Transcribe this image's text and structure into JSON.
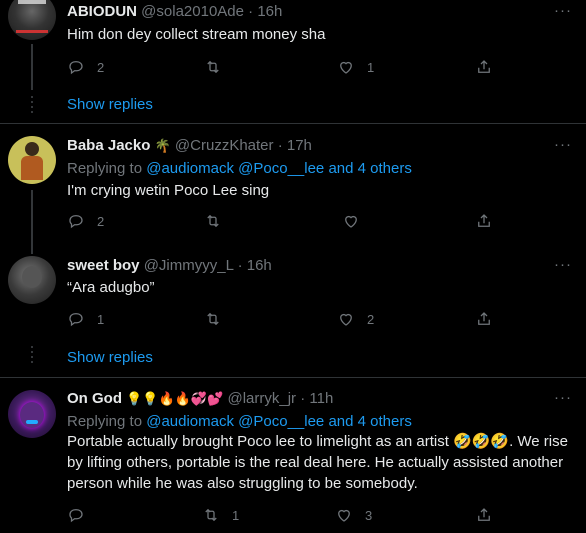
{
  "tweets": [
    {
      "name": "ABIODUN",
      "handle": "@sola2010Ade",
      "time": "16h",
      "text": "Him don dey collect stream money sha",
      "replies": "2",
      "retweets": "",
      "likes": "1",
      "show_replies": "Show replies"
    },
    {
      "name": "Baba Jacko",
      "name_emoji": "🌴",
      "handle": "@CruzzKhater",
      "time": "17h",
      "replying_prefix": "Replying to ",
      "replying_to": "@audiomack @Poco__lee and 4 others",
      "text": "I'm crying wetin Poco Lee sing",
      "replies": "2",
      "retweets": "",
      "likes": ""
    },
    {
      "name": "sweet boy",
      "handle": "@Jimmyyy_L",
      "time": "16h",
      "text": "“Ara adugbo”",
      "replies": "1",
      "retweets": "",
      "likes": "2",
      "show_replies": "Show replies"
    },
    {
      "name": "On God",
      "name_emoji": "💡💡🔥🔥💞💕",
      "handle": "@larryk_jr",
      "time": "11h",
      "replying_prefix": "Replying to ",
      "replying_to": "@audiomack @Poco__lee and 4 others",
      "text": "Portable actually brought Poco lee to limelight as an artist 🤣🤣🤣. We rise by lifting others, portable is the real deal here. He actually assisted another person while he was also struggling to be somebody.",
      "replies": "",
      "retweets": "1",
      "likes": "3"
    }
  ],
  "more_label": "···",
  "dot": "·"
}
